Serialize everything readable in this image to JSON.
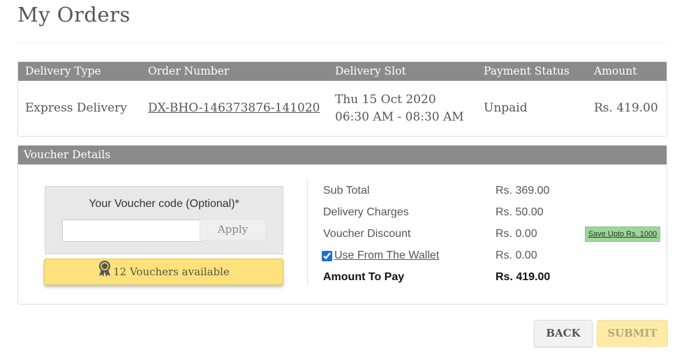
{
  "page": {
    "title": "My Orders"
  },
  "orders_table": {
    "headers": {
      "delivery_type": "Delivery Type",
      "order_number": "Order Number",
      "delivery_slot": "Delivery Slot",
      "payment_status": "Payment Status",
      "amount": "Amount"
    },
    "rows": [
      {
        "delivery_type": "Express Delivery",
        "order_number": "DX-BHO-146373876-141020",
        "delivery_date": "Thu 15 Oct 2020",
        "delivery_time": "06:30 AM - 08:30 AM",
        "payment_status": "Unpaid",
        "amount": "Rs. 419.00"
      }
    ]
  },
  "voucher": {
    "heading": "Voucher Details",
    "code_label": "Your Voucher code (Optional)*",
    "code_value": "",
    "code_placeholder": "",
    "apply_label": "Apply",
    "available_label": "12 Vouchers available",
    "medal_icon": "medal-icon"
  },
  "summary": {
    "sub_total_label": "Sub Total",
    "sub_total_value": "Rs. 369.00",
    "delivery_label": "Delivery Charges",
    "delivery_value": "Rs. 50.00",
    "discount_label": "Voucher Discount",
    "discount_value": "Rs. 0.00",
    "wallet_label": "Use From The Wallet",
    "wallet_checked": true,
    "wallet_value": "Rs. 0.00",
    "amount_label": "Amount To Pay",
    "amount_value": "Rs. 419.00",
    "save_badge": "Save Upto Rs. 1000"
  },
  "actions": {
    "back_label": "BACK",
    "submit_label": "SUBMIT"
  },
  "colors": {
    "header_gray": "#8a8a8a",
    "voucher_yellow": "#fde17a",
    "save_green": "#9fd49a",
    "submit_disabled": "#fdeaa7"
  }
}
